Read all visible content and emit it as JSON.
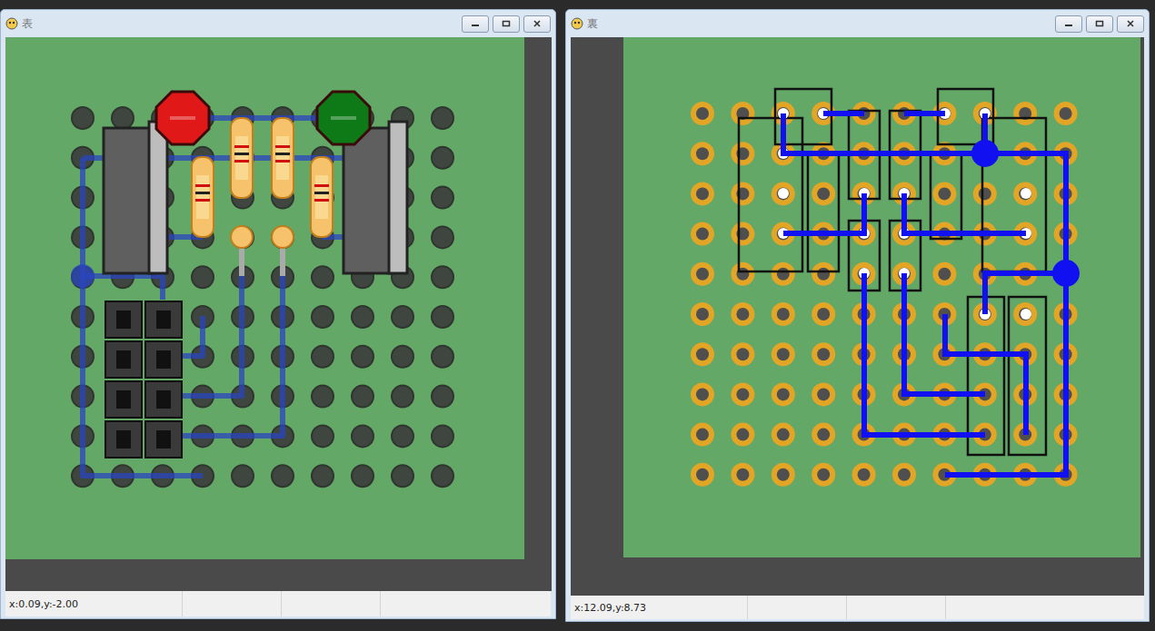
{
  "windows": [
    {
      "title": "表",
      "status": "x:0.09,y:-2.00",
      "board": {
        "side": "front",
        "leds": [
          {
            "color": "#e01818"
          },
          {
            "color": "#0d7a17"
          }
        ]
      }
    },
    {
      "title": "裏",
      "status": "x:12.09,y:8.73",
      "board": {
        "side": "back",
        "leds": []
      }
    }
  ]
}
